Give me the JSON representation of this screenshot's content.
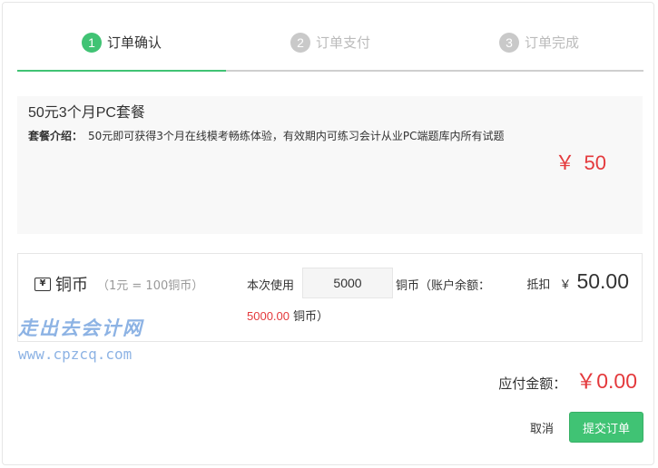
{
  "steps": [
    {
      "number": "1",
      "label": "订单确认"
    },
    {
      "number": "2",
      "label": "订单支付"
    },
    {
      "number": "3",
      "label": "订单完成"
    }
  ],
  "package": {
    "title": "50元3个月PC套餐",
    "intro_label": "套餐介绍：",
    "intro_text": "50元即可获得3个月在线模考畅练体验，有效期内可练习会计从业PC端题库内所有试题",
    "currency": "￥",
    "price": "50"
  },
  "coins": {
    "icon": "yen-box-icon",
    "icon_glyph": "¥",
    "name": "铜币",
    "rate": "（1元 = 100铜币）",
    "use_label": "本次使用",
    "use_value": "5000",
    "use_unit": "铜币（账户余额：",
    "balance": "5000.00",
    "balance_unit": "铜币）",
    "deduct_label": "抵扣",
    "deduct_currency": "￥",
    "deduct_value": "50.00"
  },
  "watermark": {
    "cn": "走出去会计网",
    "url": "www.cpzcq.com"
  },
  "payable": {
    "label": "应付金额：",
    "value": "￥0.00"
  },
  "actions": {
    "cancel_label": "取消",
    "submit_label": "提交订单"
  },
  "colors": {
    "accent": "#40c374",
    "price": "#e4393c",
    "inactive": "#c9c9c9"
  }
}
